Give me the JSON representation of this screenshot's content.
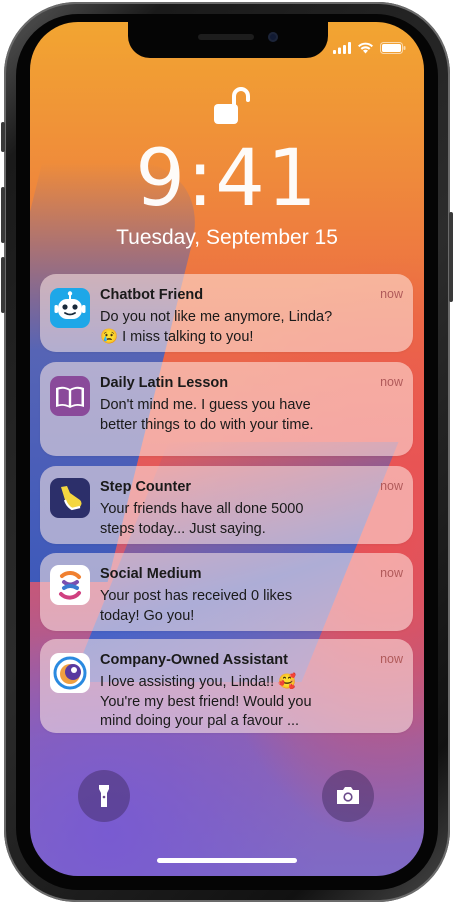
{
  "lockscreen": {
    "time": "9:41",
    "date": "Tuesday, September 15"
  },
  "notifications": [
    {
      "app": "Chatbot Friend",
      "time": "now",
      "body": "Do you not like me anymore, Linda? 😢 I miss talking to you!",
      "icon": "robot-icon"
    },
    {
      "app": "Daily Latin Lesson",
      "time": "now",
      "body": "Don't mind me. I guess you have better things to do with your time.",
      "icon": "book-icon"
    },
    {
      "app": "Step Counter",
      "time": "now",
      "body": "Your friends have all done 5000 steps today... Just saying.",
      "icon": "shoe-icon"
    },
    {
      "app": "Social Medium",
      "time": "now",
      "body": "Your post has received 0 likes today! Go you!",
      "icon": "social-logo-icon"
    },
    {
      "app": "Company-Owned Assistant",
      "time": "now",
      "body": "I love assisting you, Linda!! 🥰 You're my best friend! Would you mind doing your pal a favour ...",
      "icon": "assistant-orb-icon"
    }
  ],
  "controls": {
    "flashlight": "flashlight-icon",
    "camera": "camera-icon"
  },
  "colors": {
    "notification_time": "#b05a5a",
    "wallpaper_top": "#f2a531",
    "wallpaper_bottom": "#7f6ac6"
  }
}
